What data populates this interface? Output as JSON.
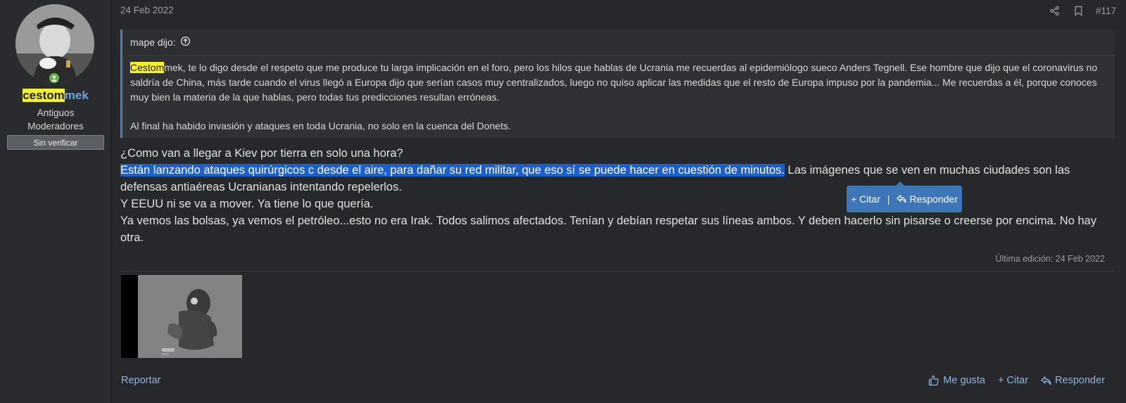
{
  "user": {
    "name_highlight": "cestom",
    "name_rest": "mek",
    "title_line1": "Antiguos",
    "title_line2": "Moderadores",
    "banner": "Sin verificar"
  },
  "post": {
    "date": "24 Feb 2022",
    "number": "#117",
    "quote": {
      "author": "mape dijo:",
      "p1_highlight": "Cestom",
      "p1_rest": "mek, te lo digo desde el respeto que me produce tu larga implicación en el foro, pero los hilos que hablas de Ucrania me recuerdas al epidemiólogo sueco Anders Tegnell. Ese hombre que dijo que el coronavirus no saldría de China, más tarde cuando el virus llegó a Europa dijo que serían casos muy centralizados, luego no quiso aplicar las medidas que el resto de Europa impuso por la pandemia... Me recuerdas a él, porque conoces muy bien la materia de la que hablas, pero todas tus predicciones resultan erróneas.",
      "p2": "Al final ha habido invasión y ataques en toda Ucrania, no solo en la cuenca del Donets."
    },
    "message": {
      "line1": "¿Como van a llegar a Kiev por tierra en solo una hora?",
      "selected": "Están lanzando ataques quirúrgicos c desde el aire, para dañar su red militar, que eso sí se puede hacer en cuestión de minutos.",
      "after_selected": " Las imágenes que se ven en muchas ciudades son las defensas antiaéreas Ucranianas intentando repelerlos.",
      "line3": "Y EEUU ni se va a mover. Ya tiene lo que quería.",
      "line4": "Ya vemos las bolsas, ya vemos el petróleo...esto no era Irak. Todos salimos afectados. Tenían y debían respetar sus líneas ambos. Y deben hacerlo sin pisarse o creerse por encima. No hay otra."
    },
    "popup": {
      "quote_label": "+ Citar",
      "separator": "|",
      "reply_label": "Responder"
    },
    "edited": "Última edición: 24 Feb 2022",
    "footer": {
      "report": "Reportar",
      "like": "Me gusta",
      "quote": "+ Citar",
      "reply": "Responder"
    }
  },
  "icons": [
    "share-icon",
    "bookmark-icon",
    "arrow-up-circle-icon",
    "thumbs-up-icon",
    "reply-icon",
    "online-status-icon"
  ],
  "colors": {
    "accent": "#4d7fb5",
    "link": "#8fb4dd",
    "username": "#70a5d8",
    "highlight": "#f5f12a",
    "selection": "#1e5fd0",
    "online": "#63b451"
  }
}
